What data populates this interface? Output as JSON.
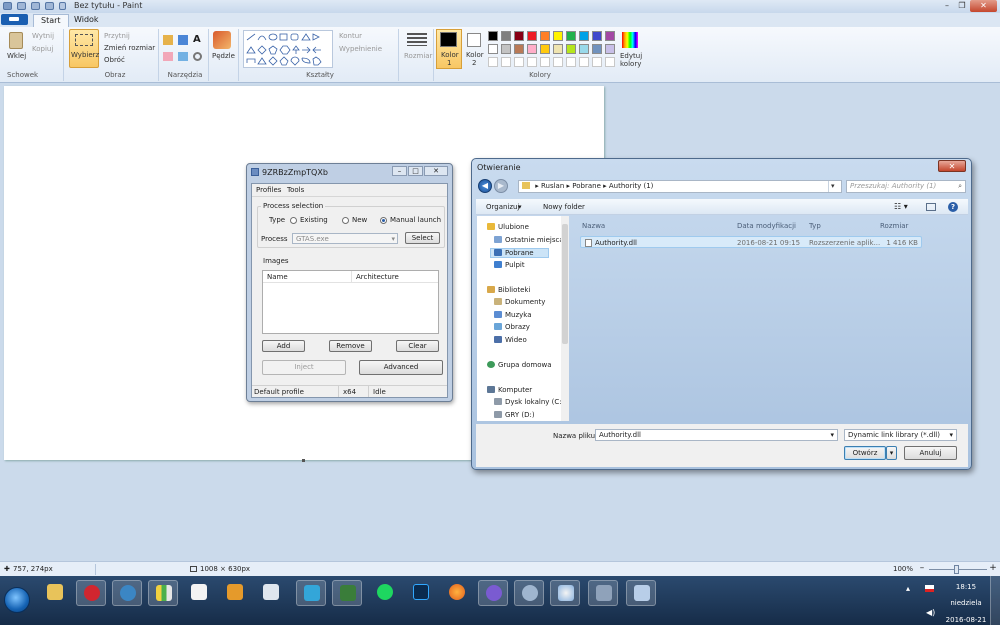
{
  "paint": {
    "title": "Bez tytułu - Paint",
    "tabs": [
      "Start",
      "Widok"
    ],
    "groups": [
      "Schowek",
      "Obraz",
      "Narzędzia",
      "Kształty",
      "Kolory"
    ],
    "clipboard": {
      "paste": "Wklej",
      "cut": "Wytnij",
      "copy": "Kopiuj"
    },
    "image": {
      "select": "Wybierz",
      "crop": "Przytnij",
      "resize": "Zmień rozmiar",
      "rotate": "Obróć"
    },
    "brushes": "Pędzle",
    "shapes": {
      "outline": "Kontur",
      "fill": "Wypełnienie"
    },
    "size": "Rozmiar",
    "color1": {
      "label": "Kolor",
      "num": "1"
    },
    "color2": {
      "label": "Kolor",
      "num": "2"
    },
    "edit_colors": {
      "l1": "Edytuj",
      "l2": "kolory"
    },
    "palette": [
      "#000000",
      "#7f7f7f",
      "#880015",
      "#ed1c24",
      "#ff7f27",
      "#fff200",
      "#22b14c",
      "#00a2e8",
      "#3f48cc",
      "#a349a4",
      "#ffffff",
      "#c3c3c3",
      "#b97a57",
      "#ffaec9",
      "#ffc90e",
      "#efe4b0",
      "#b5e61d",
      "#99d9ea",
      "#7092be",
      "#c8bfe7"
    ],
    "status": {
      "cursor": "757, 274px",
      "canvas_size": "1008 × 630px",
      "zoom": "100%"
    }
  },
  "injector": {
    "title": "9ZRBzZmpTQXb",
    "menu": [
      "Profiles",
      "Tools"
    ],
    "process_selection": "Process selection",
    "type_label": "Type",
    "types": [
      "Existing",
      "New",
      "Manual launch"
    ],
    "selected_type": "Manual launch",
    "process_label": "Process",
    "process_value": "GTAS.exe",
    "select_btn": "Select",
    "images_label": "Images",
    "columns": [
      "Name",
      "Architecture"
    ],
    "add": "Add",
    "remove": "Remove",
    "clear": "Clear",
    "inject": "Inject",
    "advanced": "Advanced",
    "status": {
      "profile": "Default profile",
      "arch": "x64",
      "state": "Idle"
    }
  },
  "dialog": {
    "title": "Otwieranie",
    "breadcrumb": [
      "Ruslan",
      "Pobrane",
      "Authority (1)"
    ],
    "search_placeholder": "Przeszukaj: Authority (1)",
    "organize": "Organizuj",
    "new_folder": "Nowy folder",
    "nav": {
      "favorites": "Ulubione",
      "recent": "Ostatnie miejsca",
      "downloads": "Pobrane",
      "desktop": "Pulpit",
      "libraries": "Biblioteki",
      "documents": "Dokumenty",
      "music": "Muzyka",
      "pictures": "Obrazy",
      "videos": "Wideo",
      "homegroup": "Grupa domowa",
      "computer": "Komputer",
      "drive_c": "Dysk lokalny (C:)",
      "drive_d": "GRY (D:)"
    },
    "columns": {
      "name": "Nazwa",
      "date": "Data modyfikacji",
      "type": "Typ",
      "size": "Rozmiar"
    },
    "files": [
      {
        "name": "Authority.dll",
        "date": "2016-08-21 09:15",
        "type": "Rozszerzenie aplik...",
        "size": "1 416 KB"
      }
    ],
    "filename_label": "Nazwa pliku:",
    "filename_value": "Authority.dll",
    "filter": "Dynamic link library (*.dll)",
    "open": "Otwórz",
    "cancel": "Anuluj"
  },
  "taskbar": {
    "time": "18:15",
    "day": "niedziela",
    "date": "2016-08-21"
  }
}
